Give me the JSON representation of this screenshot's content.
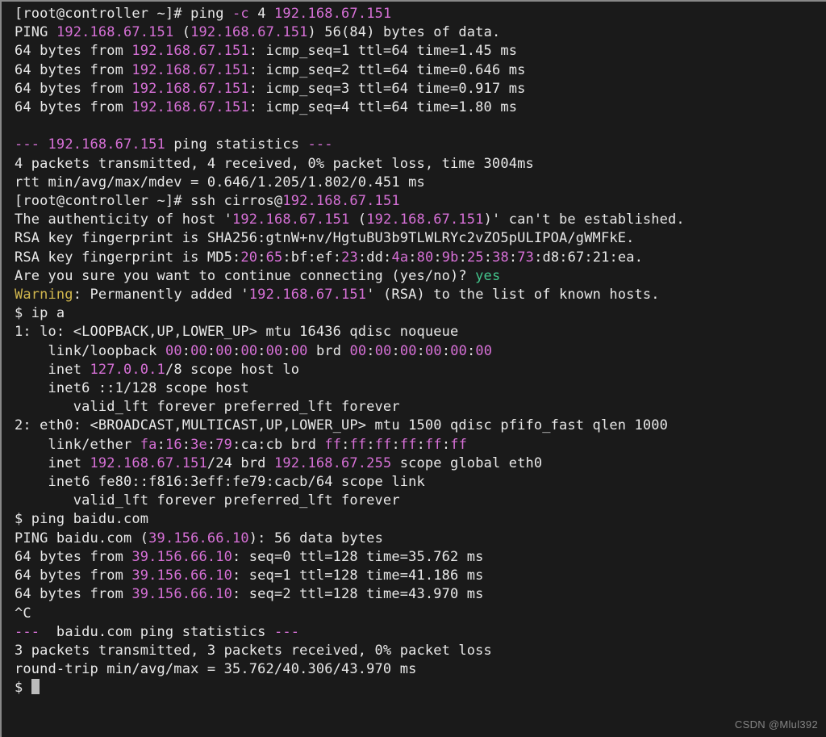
{
  "prompt1_user": "[root@controller ~]# ",
  "ping_cmd1": "ping ",
  "ping_opt1": "-c",
  "ping_cnt1": " 4 ",
  "ip_a": "192.168.67.151",
  "ping_hdr1a": "PING ",
  "ping_hdr1b": " (",
  "ping_hdr1c": ") 56(84) bytes of data.",
  "l64_before": "64 bytes from ",
  "ping1_1": ": icmp_seq=1 ttl=64 time=1.45 ms",
  "ping1_2": ": icmp_seq=2 ttl=64 time=0.646 ms",
  "ping1_3": ": icmp_seq=3 ttl=64 time=0.917 ms",
  "ping1_4": ": icmp_seq=4 ttl=64 time=1.80 ms",
  "dash3a": "--- ",
  "stats1_label": " ping statistics ",
  "dash3b": "---",
  "stats1_line1": "4 packets transmitted, 4 received, 0% packet loss, time 3004ms",
  "stats1_line2": "rtt min/avg/max/mdev = 0.646/1.205/1.802/0.451 ms",
  "ssh_cmd_before": "[root@controller ~]# ssh cirros@",
  "auth1": "The authenticity of host '",
  "auth_mid1": " (",
  "auth_close1": ")' can't be established.",
  "rsa_sha_label": "RSA key fingerprint is SHA256:gtnW+nv/HgtuBU3b9TLWLRYc2vZO5pULIPOA/gWMFkE.",
  "rsa_md5_label": "RSA key fingerprint is MD5:",
  "md5_1": "20",
  "md5_2": "65",
  "md5_bf": "bf",
  "md5_ef": "ef",
  "md5_23": "23",
  "md5_dd": "dd",
  "md5_4a": "4a",
  "md5_80": "80",
  "md5_9b": "9b",
  "md5_25": "25",
  "md5_38": "38",
  "md5_73": "73",
  "md5_tail": ":d8:67:21:ea.",
  "sure_q": "Are you sure you want to continue connecting (yes/no)? ",
  "yes": "yes",
  "warn_label": "Warning",
  "warn_rest1": ": Permanently added '",
  "warn_rest2": "' (RSA) to the list of known hosts.",
  "dollar": "$ ",
  "cmd_ipa": "ip a",
  "lo_line": "1: lo: <LOOPBACK,UP,LOWER_UP> mtu 16436 qdisc noqueue",
  "lo_link_label": "    link/loopback ",
  "mac_zero": "00",
  "brd_label": " brd ",
  "lo_inet_a": "    inet ",
  "lo_ip": "127.0.0.1",
  "lo_inet_b": "/8 scope host lo",
  "lo_inet6": "    inet6 ::1/128 scope host",
  "valid_line": "       valid_lft forever preferred_lft forever",
  "eth0_line": "2: eth0: <BROADCAST,MULTICAST,UP,LOWER_UP> mtu 1500 qdisc pfifo_fast qlen 1000",
  "eth0_link_label": "    link/ether ",
  "eth0_mac_1": "fa",
  "eth0_mac_2": "16",
  "eth0_mac_3": "3e",
  "eth0_mac_4": "79",
  "eth0_mac_5": "ca",
  "eth0_mac_6": "cb",
  "ff": "ff",
  "eth0_inet_a": "    inet ",
  "eth0_inet_b": "/24 brd ",
  "eth0_brd_ip": "192.168.67.255",
  "eth0_inet_c": " scope global eth0",
  "eth0_inet6": "    inet6 fe80::f816:3eff:fe79:cacb/64 scope link",
  "cmd_ping_baidu": "ping baidu.com",
  "baidu_hdr_a": "PING baidu.com (",
  "baidu_ip": "39.156.66.10",
  "baidu_hdr_b": "): 56 data bytes",
  "baidu_1": ": seq=0 ttl=128 time=35.762 ms",
  "baidu_2": ": seq=1 ttl=128 time=41.186 ms",
  "baidu_3": ": seq=2 ttl=128 time=43.970 ms",
  "ctrl_c": "^C",
  "baidu_stats_label": " baidu.com ping statistics ",
  "baidu_stats_1": "3 packets transmitted, 3 packets received, 0% packet loss",
  "baidu_stats_2": "round-trip min/avg/max = 35.762/40.306/43.970 ms",
  "watermark": "CSDN @Mlul392"
}
